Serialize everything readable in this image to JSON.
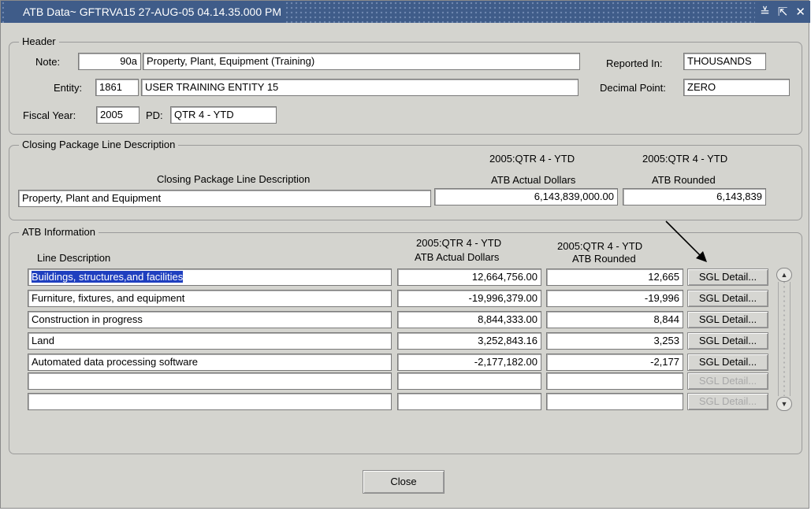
{
  "window": {
    "title": "ATB Data~ GFTRVA15 27-AUG-05 04.14.35.000 PM",
    "controls": [
      "≚",
      "⇱",
      "✕"
    ]
  },
  "header": {
    "legend": "Header",
    "note_label": "Note:",
    "note_code": "90a",
    "note_desc": "Property, Plant, Equipment (Training)",
    "reported_in_label": "Reported In:",
    "reported_in": "THOUSANDS",
    "entity_label": "Entity:",
    "entity_code": "1861",
    "entity_name": "USER TRAINING ENTITY 15",
    "decimal_label": "Decimal Point:",
    "decimal": "ZERO",
    "fy_label": "Fiscal Year:",
    "fy": "2005",
    "pd_label": "PD:",
    "pd": "QTR 4 - YTD"
  },
  "closing": {
    "legend": "Closing Package Line Description",
    "col_desc": "Closing Package Line Description",
    "col_actual_period": "2005:QTR 4 - YTD",
    "col_actual": "ATB Actual Dollars",
    "col_rounded_period": "2005:QTR 4 - YTD",
    "col_rounded": "ATB Rounded",
    "desc": "Property, Plant and Equipment",
    "actual": "6,143,839,000.00",
    "rounded": "6,143,839"
  },
  "atb": {
    "legend": "ATB Information",
    "col_desc": "Line Description",
    "col_actual_period": "2005:QTR 4 - YTD",
    "col_actual": "ATB Actual Dollars",
    "col_rounded_period": "2005:QTR 4 - YTD",
    "col_rounded": "ATB Rounded",
    "sgl_label": "SGL Detail...",
    "rows": [
      {
        "desc": "Buildings, structures,and facilities",
        "actual": "12,664,756.00",
        "rounded": "12,665"
      },
      {
        "desc": "Furniture, fixtures, and equipment",
        "actual": "-19,996,379.00",
        "rounded": "-19,996"
      },
      {
        "desc": "Construction in progress",
        "actual": "8,844,333.00",
        "rounded": "8,844"
      },
      {
        "desc": "Land",
        "actual": "3,252,843.16",
        "rounded": "3,253"
      },
      {
        "desc": "Automated data processing software",
        "actual": "-2,177,182.00",
        "rounded": "-2,177"
      },
      {
        "desc": "",
        "actual": "",
        "rounded": ""
      },
      {
        "desc": "",
        "actual": "",
        "rounded": ""
      }
    ]
  },
  "footer": {
    "close_label": "Close"
  },
  "colors": {
    "titlebar": "#3f5c89",
    "window": "#d4d4cf",
    "selection": "#1f3fbf"
  }
}
